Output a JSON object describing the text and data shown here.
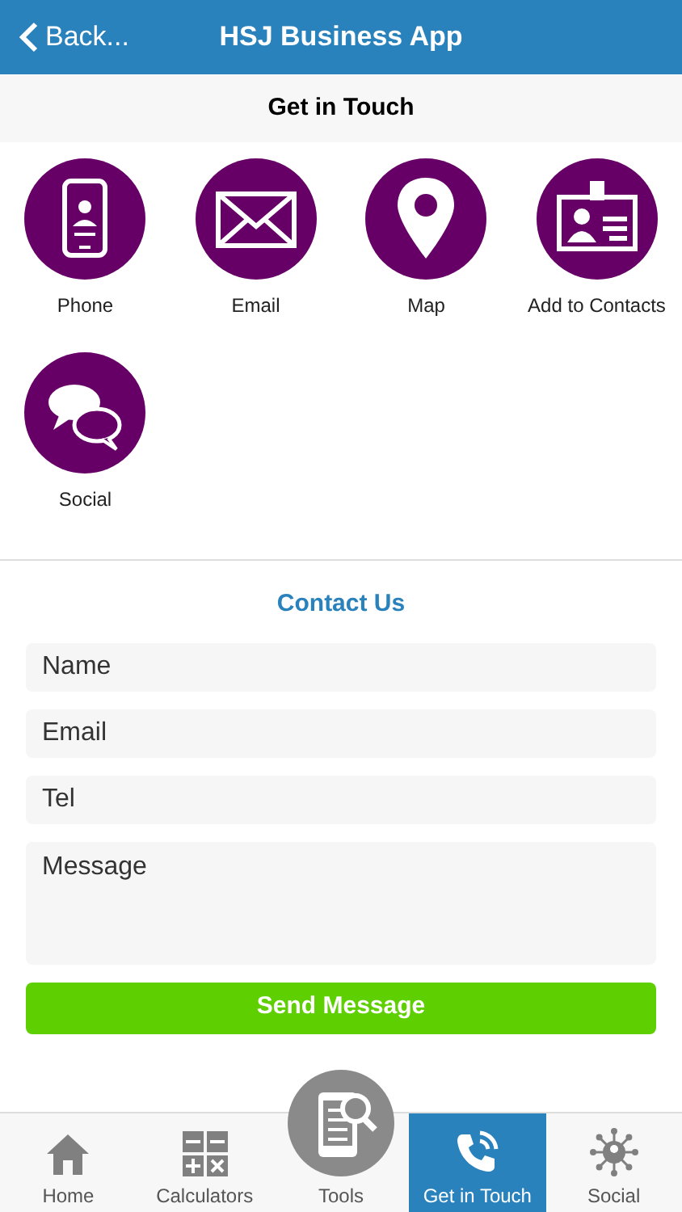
{
  "header": {
    "back": "Back...",
    "title": "HSJ Business App"
  },
  "subheader": "Get in Touch",
  "actions": [
    {
      "label": "Phone",
      "kind": "phone"
    },
    {
      "label": "Email",
      "kind": "email"
    },
    {
      "label": "Map",
      "kind": "map"
    },
    {
      "label": "Add to Contacts",
      "kind": "contact"
    },
    {
      "label": "Social",
      "kind": "social"
    }
  ],
  "form": {
    "title": "Contact Us",
    "fields": [
      {
        "placeholder": "Name",
        "kind": "line"
      },
      {
        "placeholder": "Email",
        "kind": "line"
      },
      {
        "placeholder": "Tel",
        "kind": "line"
      },
      {
        "placeholder": "Message",
        "kind": "area"
      }
    ],
    "submit": "Send Message"
  },
  "tabs": [
    {
      "label": "Home",
      "kind": "home",
      "selected": false
    },
    {
      "label": "Calculators",
      "kind": "calc",
      "selected": false
    },
    {
      "label": "Tools",
      "kind": "tools",
      "selected": false
    },
    {
      "label": "Get in Touch",
      "kind": "phone",
      "selected": true
    },
    {
      "label": "Social",
      "kind": "social",
      "selected": false
    }
  ]
}
